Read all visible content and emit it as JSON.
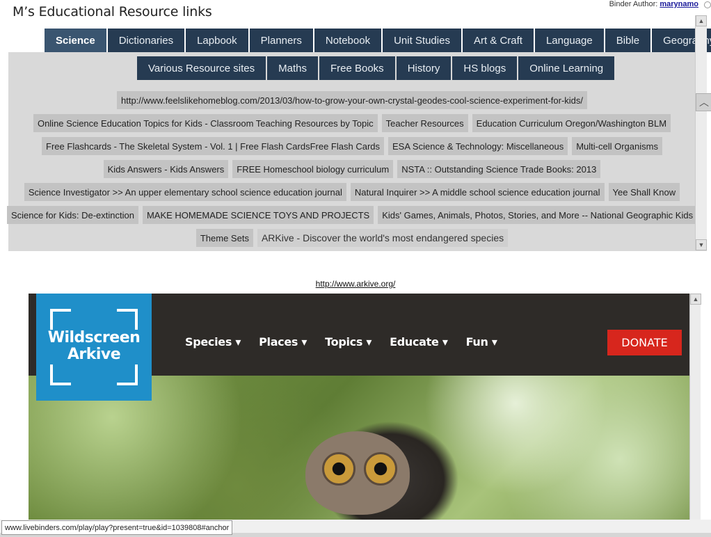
{
  "binder": {
    "title": "M’s Educational Resource links",
    "author_label": "Binder Author:",
    "author_name": "marynamo"
  },
  "tabs_row1": [
    "Science",
    "Dictionaries",
    "Lapbook",
    "Planners",
    "Notebook",
    "Unit Studies",
    "Art & Craft",
    "Language",
    "Bible",
    "Geography"
  ],
  "tabs_row2": [
    "Various Resource sites",
    "Maths",
    "Free Books",
    "History",
    "HS blogs",
    "Online Learning"
  ],
  "links": [
    [
      "http://www.feelslikehomeblog.com/2013/03/how-to-grow-your-own-crystal-geodes-cool-science-experiment-for-kids/"
    ],
    [
      "Online Science Education Topics for Kids - Classroom Teaching Resources by Topic",
      "Teacher Resources",
      "Education Curriculum Oregon/Washington BLM"
    ],
    [
      "Free Flashcards - The Skeletal System - Vol. 1 | Free Flash CardsFree Flash Cards",
      "ESA Science & Technology: Miscellaneous",
      "Multi-cell Organisms"
    ],
    [
      "Kids Answers - Kids Answers",
      "FREE Homeschool biology curriculum",
      "NSTA :: Outstanding Science Trade Books: 2013"
    ],
    [
      "Science Investigator >> An upper elementary school science education journal",
      "Natural Inquirer >> A middle school science education journal",
      "Yee Shall Know"
    ],
    [
      "Science for Kids: De-extinction",
      "MAKE HOMEMADE SCIENCE TOYS AND PROJECTS",
      "Kids' Games, Animals, Photos, Stories, and More -- National Geographic Kids"
    ],
    [
      "Theme Sets",
      "ARKive - Discover the world's most endangered species"
    ]
  ],
  "selected_link": "ARKive - Discover the world's most endangered species",
  "page_url": "http://www.arkive.org/",
  "site": {
    "logo_line1": "Wildscreen",
    "logo_line2": "Arkive",
    "menu": [
      "Species ▾",
      "Places ▾",
      "Topics ▾",
      "Educate ▾",
      "Fun ▾"
    ],
    "donate": "DONATE"
  },
  "status_url": "www.livebinders.com/play/play?present=true&id=1039808#anchor",
  "colors": {
    "tab_bg": "#263b52",
    "panel_bg": "#d9d9d9",
    "link_bg": "#c3c3c3",
    "logo_blue": "#1f8fc9",
    "donate_red": "#d7261d",
    "site_nav_bg": "#2e2b28"
  },
  "icons": {
    "collapse": "chevron-up-icon",
    "scroll_up": "arrow-up-icon",
    "scroll_down": "arrow-down-icon"
  }
}
